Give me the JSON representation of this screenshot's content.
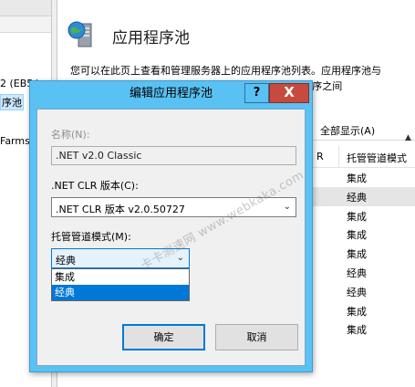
{
  "left_tree": {
    "server_item": "2 (EB5 \\",
    "pools_item": "序池",
    "farms_item": "Farms"
  },
  "main": {
    "title": "应用程序池",
    "description_lines": [
      "您可以在此页上查看和管理服务器上的应用程序池列表。应用程序池与",
      "                                                         供不同应用程序之间"
    ],
    "show_all": "全部显示(A)",
    "column_headers": {
      "partial": "R",
      "pipeline_mode": "托管管道模式"
    },
    "rows": [
      {
        "mode": "集成",
        "selected": false
      },
      {
        "mode": "经典",
        "selected": true
      },
      {
        "mode": "集成",
        "selected": false
      },
      {
        "mode": "集成",
        "selected": false
      },
      {
        "mode": "集成",
        "selected": false
      },
      {
        "mode": "经典",
        "selected": false
      },
      {
        "mode": "经典",
        "selected": false
      },
      {
        "mode": "集成",
        "selected": false
      },
      {
        "mode": "集成",
        "selected": false
      }
    ]
  },
  "dialog": {
    "title": "编辑应用程序池",
    "help_label": "?",
    "close_label": "X",
    "name_label": "名称(N):",
    "name_value": ".NET v2.0 Classic",
    "clr_label": ".NET CLR 版本(C):",
    "clr_value": ".NET CLR 版本 v2.0.50727",
    "mode_label": "托管管道模式(M):",
    "mode_value": "经典",
    "mode_options": [
      "集成",
      "经典"
    ],
    "ok_label": "确定",
    "cancel_label": "取消",
    "dropdown_arrow": "⌄"
  },
  "watermark": "卡卡测速网 www.webkaka.com",
  "colors": {
    "dialog_frame": "#5ac1f3",
    "close_button": "#c74a3f",
    "selection": "#0078d7"
  },
  "icons": {
    "main_icon": "server-globe-icon",
    "dropdown": "chevron-down-icon",
    "scroll": "scroll-arrow-icon"
  }
}
